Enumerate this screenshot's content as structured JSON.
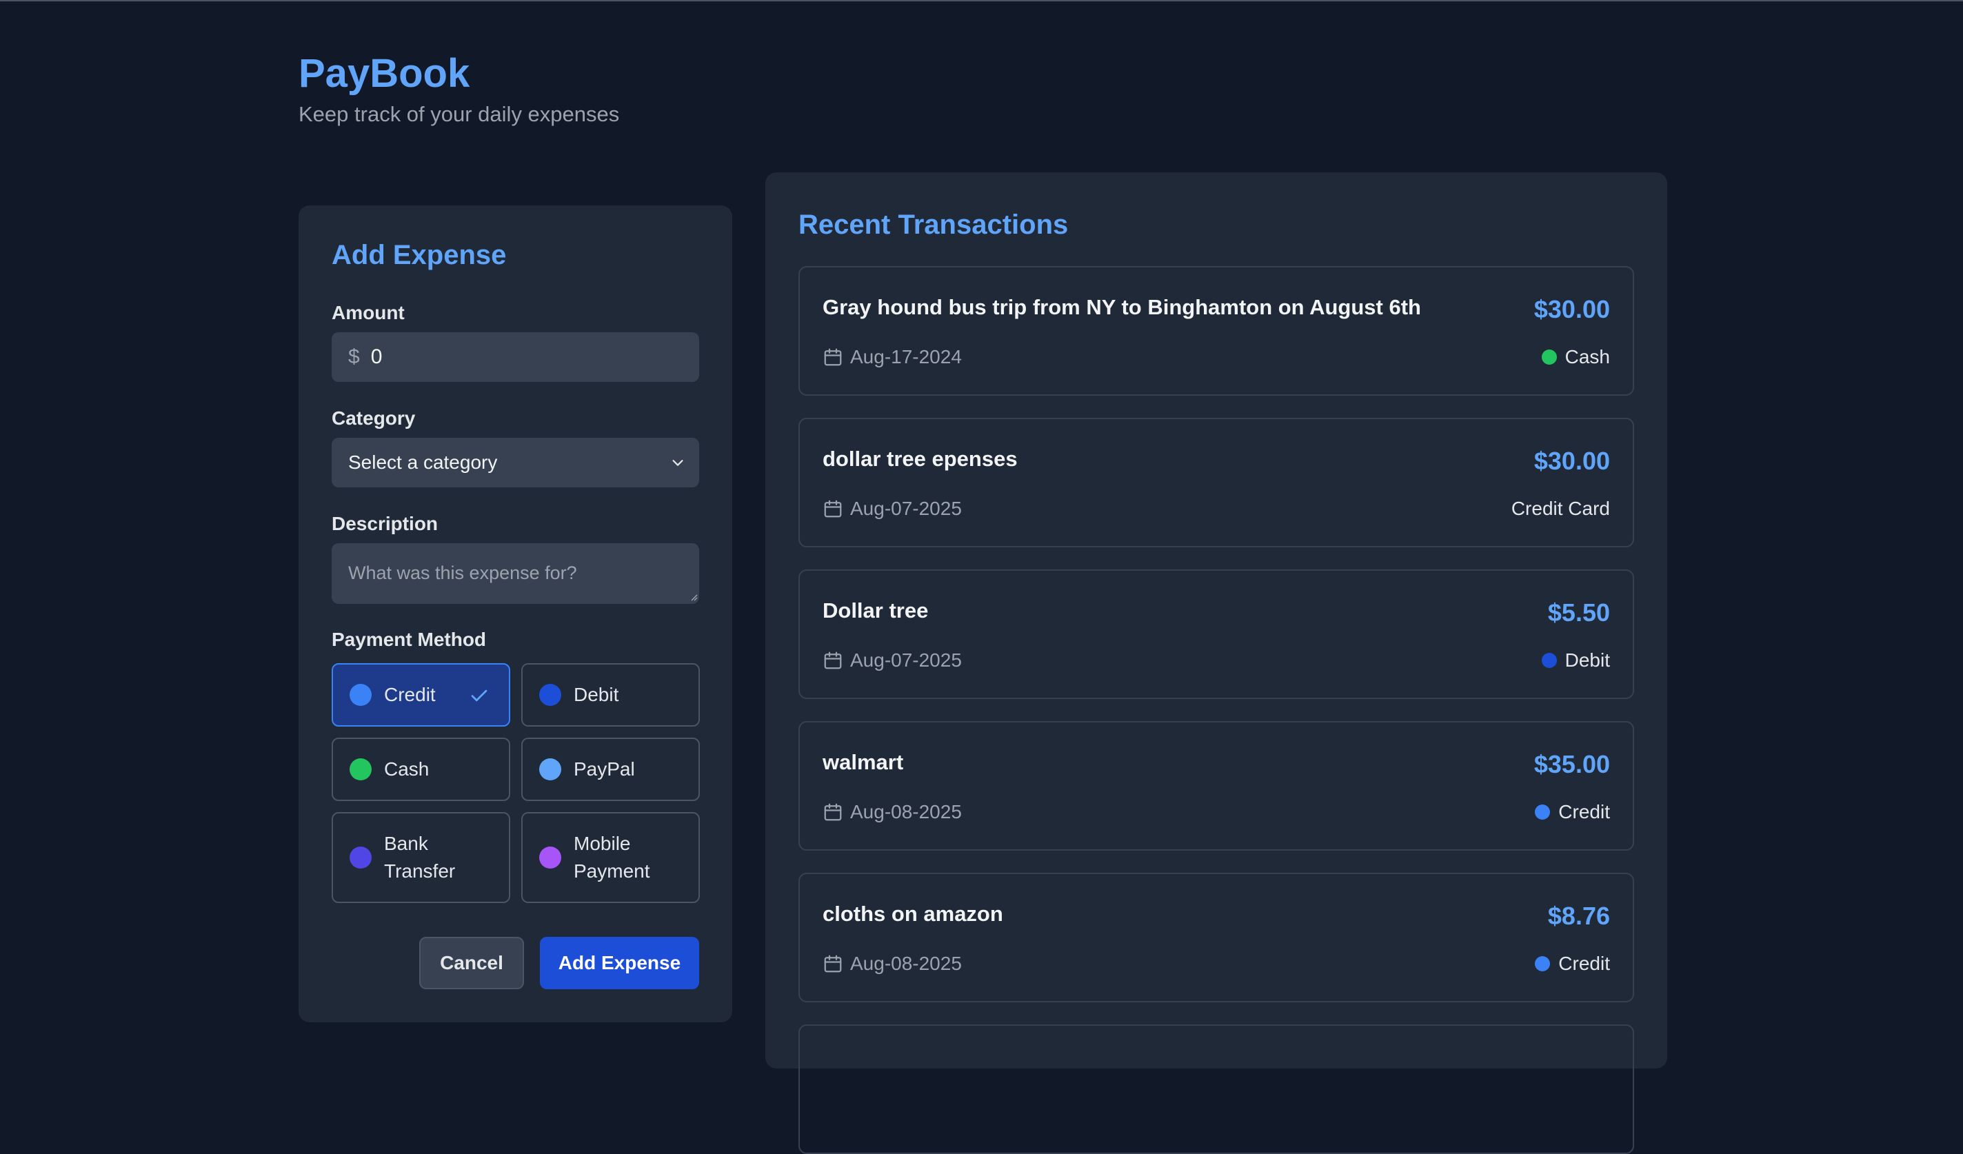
{
  "app": {
    "title": "PayBook",
    "subtitle": "Keep track of your daily expenses"
  },
  "form": {
    "title": "Add Expense",
    "amount_label": "Amount",
    "amount_prefix": "$",
    "amount_value": "0",
    "category_label": "Category",
    "category_value": "Select a category",
    "description_label": "Description",
    "description_placeholder": "What was this expense for?",
    "payment_label": "Payment Method",
    "payment_methods": [
      {
        "label": "Credit",
        "color": "#3b82f6",
        "selected": true
      },
      {
        "label": "Debit",
        "color": "#1d4ed8",
        "selected": false
      },
      {
        "label": "Cash",
        "color": "#22c55e",
        "selected": false
      },
      {
        "label": "PayPal",
        "color": "#60a5fa",
        "selected": false
      },
      {
        "label": "Bank Transfer",
        "color": "#4f46e5",
        "selected": false
      },
      {
        "label": "Mobile Payment",
        "color": "#a855f7",
        "selected": false
      }
    ],
    "cancel_label": "Cancel",
    "submit_label": "Add Expense"
  },
  "transactions": {
    "title": "Recent Transactions",
    "items": [
      {
        "description": "Gray hound bus trip from NY to Binghamton on August 6th",
        "amount": "$30.00",
        "date": "Aug-17-2024",
        "method": "Cash",
        "method_color": "#22c55e"
      },
      {
        "description": "dollar tree epenses",
        "amount": "$30.00",
        "date": "Aug-07-2025",
        "method": "Credit Card",
        "method_color": ""
      },
      {
        "description": "Dollar tree",
        "amount": "$5.50",
        "date": "Aug-07-2025",
        "method": "Debit",
        "method_color": "#1d4ed8"
      },
      {
        "description": "walmart",
        "amount": "$35.00",
        "date": "Aug-08-2025",
        "method": "Credit",
        "method_color": "#3b82f6"
      },
      {
        "description": "cloths on amazon",
        "amount": "$8.76",
        "date": "Aug-08-2025",
        "method": "Credit",
        "method_color": "#3b82f6"
      }
    ]
  },
  "icons": {
    "calendar": "calendar-icon",
    "check": "check-icon",
    "chevron": "chevron-down-icon"
  }
}
